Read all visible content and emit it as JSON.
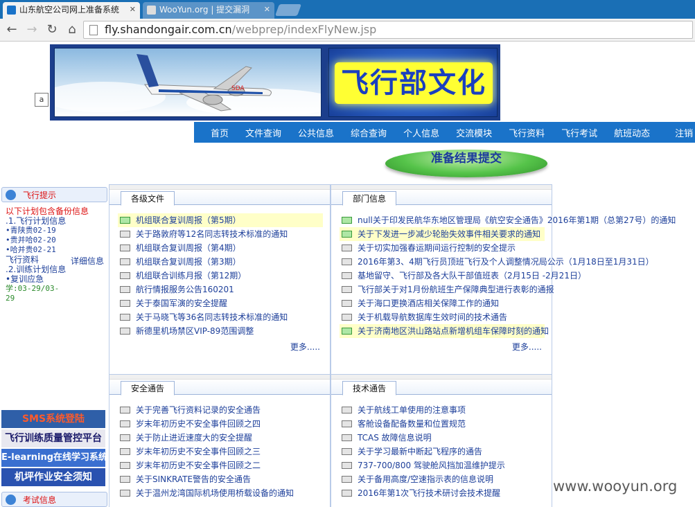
{
  "browser": {
    "tabs": [
      {
        "title": "山东航空公司网上准备系统"
      },
      {
        "title": "WooYun.org | 提交漏洞"
      }
    ],
    "url": {
      "host": "fly.shandongair.com.cn",
      "path": "/webprep/indexFlyNew.jsp"
    }
  },
  "banner": {
    "culture_title": "飞行部文化",
    "anchor_label": "a"
  },
  "nav": {
    "items": [
      "首页",
      "文件查询",
      "公共信息",
      "综合查询",
      "个人信息",
      "交流模块",
      "飞行资料",
      "飞行考试",
      "航班动态",
      "注销"
    ]
  },
  "submit_button": "准备结果提交",
  "sidebar": {
    "title": "飞行提示",
    "backup_line": "以下计划包含备份信息",
    "plan_header": ".1.飞行计划信息",
    "plans": [
      "•青陕贵02-19",
      "•贵并哈02-20",
      "•哈并贵02-21"
    ],
    "data_label": "飞行资料",
    "detail_link": "详细信息",
    "training_header": ".2.训练计划信息",
    "training_item": "•复训应急",
    "date_line1": "学:03-29/03-",
    "date_line2": "29",
    "promos": [
      "SMS系统登陆",
      "飞行训练质量管控平台",
      "E-learning在线学习系统",
      "机坪作业安全须知"
    ],
    "exam_title": "考试信息"
  },
  "panels": {
    "files": {
      "tab": "各级文件",
      "more": "更多.....",
      "items": [
        "机组联合复训周报（第5期）",
        "关于路敦府等12名同志转技术标准的通知",
        "机组联合复训周报（第4期）",
        "机组联合复训周报（第3期）",
        "机组联合训练月报（第12期）",
        "航行情报服务公告160201",
        "关于泰国军演的安全提醒",
        "关于马晓飞等36名同志转技术标准的通知",
        "新德里机场禁区VIP-89范围调整"
      ]
    },
    "dept": {
      "tab": "部门信息",
      "more": "更多.....",
      "items": [
        "null关于印发民航华东地区管理局《航空安全通告》2016年第1期（总第27号）的通知",
        "关于下发进一步减少轮胎失效事件相关要求的通知",
        "关于切实加强春运期间运行控制的安全提示",
        "2016年第3、4期飞行员顶班飞行及个人调整情况局公示（1月18日至1月31日）",
        "基地留守、飞行部及各大队干部值班表（2月15日 -2月21日）",
        "飞行部关于对1月份航班生产保障典型进行表彰的通报",
        "关于海口更换酒店相关保障工作的通知",
        "关于机载导航数据库生效时间的技术通告",
        "关于济南地区洪山路站点新增机组车保障时刻的通知"
      ]
    },
    "safety": {
      "tab": "安全通告",
      "items": [
        "关于完善飞行资料记录的安全通告",
        "岁末年初历史不安全事件回顾之四",
        "关于防止进近速度大的安全提醒",
        "岁末年初历史不安全事件回顾之三",
        "岁末年初历史不安全事件回顾之二",
        "关于SINKRATE警告的安全通告",
        "关于温州龙湾国际机场使用桥载设备的通知"
      ]
    },
    "tech": {
      "tab": "技术通告",
      "items": [
        "关于航线工单使用的注意事项",
        "客舱设备配备数量和位置规范",
        "TCAS 故障信息说明",
        "关于学习最新中断起飞程序的通告",
        "737-700/800 驾驶舱风挡加温维护提示",
        "关于备用高度/空速指示表的信息说明",
        "2016年第1次飞行技术研讨会技术提醒"
      ]
    }
  },
  "watermark": "www.wooyun.org",
  "colors": {
    "nav_bar": "#1a73c9",
    "tab_bar": "#1a6fb5",
    "link": "#1d3f9a",
    "alert": "#dd1111",
    "highlight": "#ffffc8"
  }
}
